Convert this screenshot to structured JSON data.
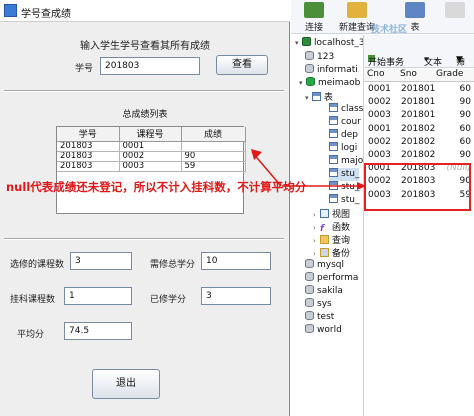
{
  "window": {
    "title": "学号查成绩",
    "prompt": "输入学生学号查看其所有成绩",
    "student_id_label": "学号",
    "student_id_value": "201803",
    "query_button": "查看",
    "grades_title": "总成绩列表",
    "grades_table": {
      "columns": [
        "学号",
        "课程号",
        "成绩"
      ],
      "rows": [
        [
          "201803",
          "0001",
          ""
        ],
        [
          "201803",
          "0002",
          "90"
        ],
        [
          "201803",
          "0003",
          "59"
        ]
      ]
    },
    "stats": {
      "elective_count_label": "选修的课程数",
      "elective_count_value": "3",
      "required_credits_label": "需修总学分",
      "required_credits_value": "10",
      "failed_count_label": "挂科课程数",
      "failed_count_value": "1",
      "earned_credits_label": "已修学分",
      "earned_credits_value": "3",
      "average_label": "平均分",
      "average_value": "74.5"
    },
    "exit_button": "退出"
  },
  "annotation": {
    "text": "null代表成绩还未登记，所以不计入挂科数，不计算平均分",
    "color": "#e01818"
  },
  "navicat": {
    "toolbar": {
      "connect": "连接",
      "new_query": "新建查询",
      "tables": "表",
      "watermark": "技术社区"
    },
    "tree": [
      {
        "label": "localhost_3",
        "icon": "connection-icon",
        "level": 0
      },
      {
        "label": "123",
        "icon": "database-icon",
        "level": 1
      },
      {
        "label": "informati",
        "icon": "database-icon",
        "level": 1
      },
      {
        "label": "meimaob",
        "icon": "database-open-icon",
        "level": 1
      },
      {
        "label": "表",
        "icon": "tables-folder-icon",
        "level": 2
      },
      {
        "label": "class",
        "icon": "table-icon",
        "level": 3
      },
      {
        "label": "cour",
        "icon": "table-icon",
        "level": 3
      },
      {
        "label": "dep",
        "icon": "table-icon",
        "level": 3
      },
      {
        "label": "logi",
        "icon": "table-icon",
        "level": 3
      },
      {
        "label": "majo",
        "icon": "table-icon",
        "level": 3
      },
      {
        "label": "stu_",
        "icon": "table-icon",
        "level": 3
      },
      {
        "label": "stu_",
        "icon": "table-icon",
        "level": 3
      },
      {
        "label": "stu_",
        "icon": "table-icon",
        "level": 3
      },
      {
        "label": "视图",
        "icon": "views-folder-icon",
        "level": 2
      },
      {
        "label": "函数",
        "icon": "function-icon",
        "level": 2
      },
      {
        "label": "查询",
        "icon": "query-folder-icon",
        "level": 2
      },
      {
        "label": "备份",
        "icon": "backup-folder-icon",
        "level": 2
      },
      {
        "label": "mysql",
        "icon": "database-icon",
        "level": 1
      },
      {
        "label": "performa",
        "icon": "database-icon",
        "level": 1
      },
      {
        "label": "sakila",
        "icon": "database-icon",
        "level": 1
      },
      {
        "label": "sys",
        "icon": "database-icon",
        "level": 1
      },
      {
        "label": "test",
        "icon": "database-icon",
        "level": 1
      },
      {
        "label": "world",
        "icon": "database-icon",
        "level": 1
      }
    ],
    "grid_toolbar": {
      "begin_transaction": "开始事务",
      "text": "文本",
      "filter": "筛"
    },
    "grid": {
      "columns": [
        "Cno",
        "Sno",
        "Grade"
      ],
      "rows": [
        [
          "0001",
          "201801",
          "60"
        ],
        [
          "0002",
          "201801",
          "90"
        ],
        [
          "0003",
          "201801",
          "90"
        ],
        [
          "0001",
          "201802",
          "60"
        ],
        [
          "0002",
          "201802",
          "60"
        ],
        [
          "0003",
          "201802",
          "90"
        ],
        [
          "0001",
          "201803",
          "(Null)"
        ],
        [
          "0002",
          "201803",
          "90"
        ],
        [
          "0003",
          "201803",
          "59"
        ]
      ]
    }
  }
}
